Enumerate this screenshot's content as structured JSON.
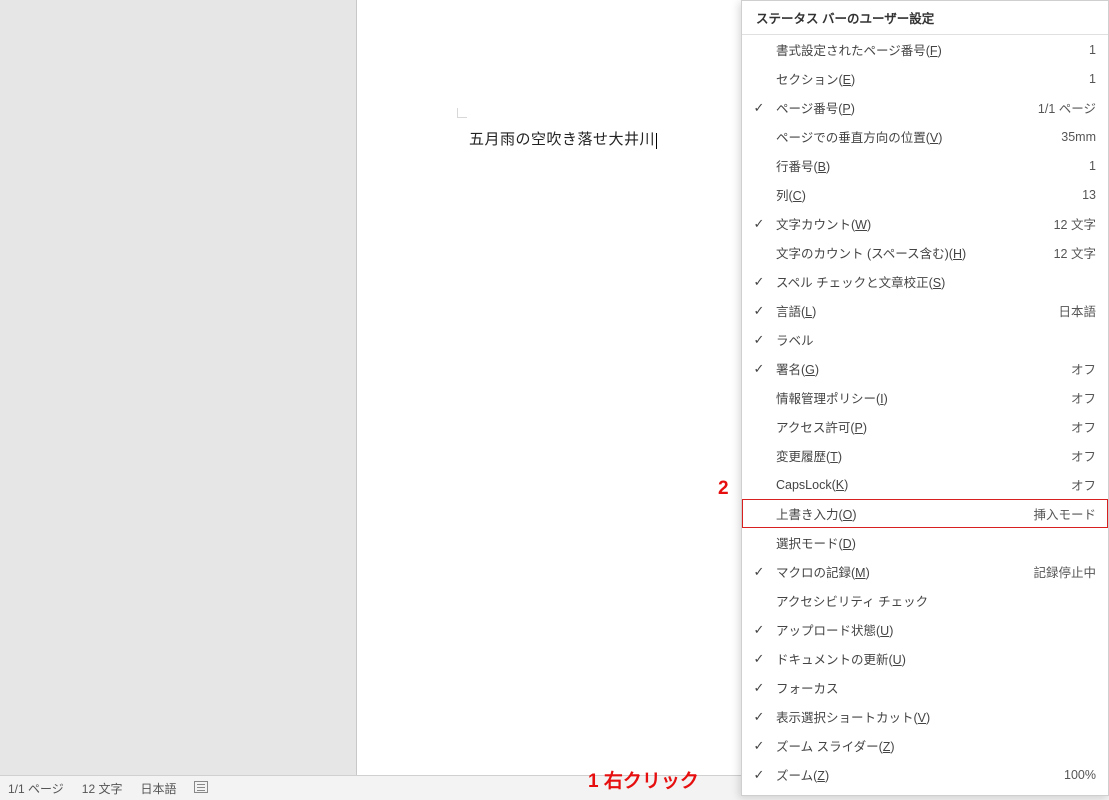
{
  "document": {
    "body_text": "五月雨の空吹き落せ大井川"
  },
  "statusbar": {
    "page": "1/1 ページ",
    "word_count": "12 文字",
    "language": "日本語"
  },
  "annotations": {
    "one": "1 右クリック",
    "two": "2"
  },
  "menu": {
    "title": "ステータス バーのユーザー設定",
    "items": [
      {
        "id": "formatted-page",
        "checked": false,
        "label_pre": "書式設定されたページ番号(",
        "hot": "F",
        "label_post": ")",
        "value": "1"
      },
      {
        "id": "section",
        "checked": false,
        "label_pre": "セクション(",
        "hot": "E",
        "label_post": ")",
        "value": "1"
      },
      {
        "id": "page-number",
        "checked": true,
        "label_pre": "ページ番号(",
        "hot": "P",
        "label_post": ")",
        "value": "1/1 ページ"
      },
      {
        "id": "vertical-pos",
        "checked": false,
        "label_pre": "ページでの垂直方向の位置(",
        "hot": "V",
        "label_post": ")",
        "value": "35mm"
      },
      {
        "id": "line-number",
        "checked": false,
        "label_pre": "行番号(",
        "hot": "B",
        "label_post": ")",
        "value": "1"
      },
      {
        "id": "column",
        "checked": false,
        "label_pre": "列(",
        "hot": "C",
        "label_post": ")",
        "value": "13"
      },
      {
        "id": "word-count",
        "checked": true,
        "label_pre": "文字カウント(",
        "hot": "W",
        "label_post": ")",
        "value": "12 文字"
      },
      {
        "id": "char-count-sp",
        "checked": false,
        "label_pre": "文字のカウント (スペース含む)(",
        "hot": "H",
        "label_post": ")",
        "value": "12 文字"
      },
      {
        "id": "spell-grammar",
        "checked": true,
        "label_pre": "スペル チェックと文章校正(",
        "hot": "S",
        "label_post": ")",
        "value": ""
      },
      {
        "id": "language",
        "checked": true,
        "label_pre": "言語(",
        "hot": "L",
        "label_post": ")",
        "value": "日本語"
      },
      {
        "id": "label",
        "checked": true,
        "label_pre": "ラベル",
        "hot": "",
        "label_post": "",
        "value": ""
      },
      {
        "id": "signatures",
        "checked": true,
        "label_pre": "署名(",
        "hot": "G",
        "label_post": ")",
        "value": "オフ"
      },
      {
        "id": "info-policy",
        "checked": false,
        "label_pre": "情報管理ポリシー(",
        "hot": "I",
        "label_post": ")",
        "value": "オフ"
      },
      {
        "id": "permissions",
        "checked": false,
        "label_pre": "アクセス許可(",
        "hot": "P",
        "label_post": ")",
        "value": "オフ"
      },
      {
        "id": "track-changes",
        "checked": false,
        "label_pre": "変更履歴(",
        "hot": "T",
        "label_post": ")",
        "value": "オフ"
      },
      {
        "id": "caps-lock",
        "checked": false,
        "label_pre": "CapsLock(",
        "hot": "K",
        "label_post": ")",
        "value": "オフ"
      },
      {
        "id": "overtype",
        "checked": false,
        "label_pre": "上書き入力(",
        "hot": "O",
        "label_post": ")",
        "value": "挿入モード",
        "highlight": true
      },
      {
        "id": "selection-mode",
        "checked": false,
        "label_pre": "選択モード(",
        "hot": "D",
        "label_post": ")",
        "value": ""
      },
      {
        "id": "macro-record",
        "checked": true,
        "label_pre": "マクロの記録(",
        "hot": "M",
        "label_post": ")",
        "value": "記録停止中"
      },
      {
        "id": "accessibility",
        "checked": false,
        "label_pre": "アクセシビリティ チェック",
        "hot": "",
        "label_post": "",
        "value": ""
      },
      {
        "id": "upload-status",
        "checked": true,
        "label_pre": "アップロード状態(",
        "hot": "U",
        "label_post": ")",
        "value": ""
      },
      {
        "id": "doc-updates",
        "checked": true,
        "label_pre": "ドキュメントの更新(",
        "hot": "U",
        "label_post": ")",
        "value": ""
      },
      {
        "id": "focus",
        "checked": true,
        "label_pre": "フォーカス",
        "hot": "",
        "label_post": "",
        "value": ""
      },
      {
        "id": "view-shortcuts",
        "checked": true,
        "label_pre": "表示選択ショートカット(",
        "hot": "V",
        "label_post": ")",
        "value": ""
      },
      {
        "id": "zoom-slider",
        "checked": true,
        "label_pre": "ズーム スライダー(",
        "hot": "Z",
        "label_post": ")",
        "value": ""
      },
      {
        "id": "zoom",
        "checked": true,
        "label_pre": "ズーム(",
        "hot": "Z",
        "label_post": ")",
        "value": "100%"
      }
    ]
  }
}
